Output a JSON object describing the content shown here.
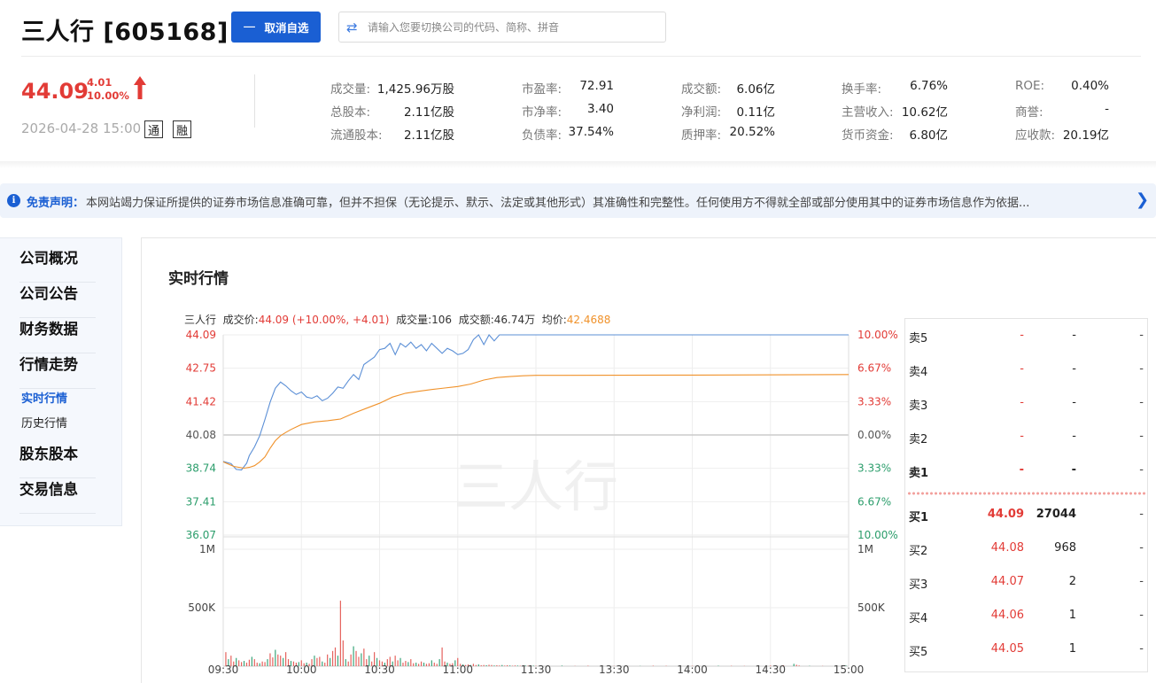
{
  "header": {
    "title": "三人行 [605168]",
    "cancel_button": "取消自选",
    "search_placeholder": "请输入您要切换公司的代码、简称、拼音"
  },
  "quote": {
    "price": "44.09",
    "change": "4.01",
    "change_pct": "10.00%",
    "datetime": "2026-04-28 15:00",
    "tag_tong": "通",
    "tag_rong": "融",
    "stats": [
      {
        "label": "成交量:",
        "value": "1,425.96万股"
      },
      {
        "label": "总股本:",
        "value": "2.11亿股"
      },
      {
        "label": "流通股本:",
        "value": "2.11亿股"
      },
      {
        "label": "市盈率:",
        "value": "72.91"
      },
      {
        "label": "市净率:",
        "value": "3.40"
      },
      {
        "label": "负债率:",
        "value": "37.54%"
      },
      {
        "label": "成交额:",
        "value": "6.06亿"
      },
      {
        "label": "净利润:",
        "value": "0.11亿"
      },
      {
        "label": "质押率:",
        "value": "20.52%"
      },
      {
        "label": "换手率:",
        "value": "6.76%"
      },
      {
        "label": "主营收入:",
        "value": "10.62亿"
      },
      {
        "label": "货币资金:",
        "value": "6.80亿"
      },
      {
        "label": "ROE:",
        "value": "0.40%"
      },
      {
        "label": "商誉:",
        "value": "-"
      },
      {
        "label": "应收款:",
        "value": "20.19亿"
      }
    ]
  },
  "disclaimer": {
    "title": "免责声明：",
    "text": "本网站竭力保证所提供的证券市场信息准确可靠，但并不担保（无论提示、默示、法定或其他形式）其准确性和完整性。任何使用方不得就全部或部分使用其中的证券市场信息作为依据..."
  },
  "sidebar": {
    "items": [
      "公司概况",
      "公司公告",
      "财务数据",
      "行情走势",
      "股东股本",
      "交易信息"
    ],
    "subitems": [
      "实时行情",
      "历史行情"
    ]
  },
  "panel": {
    "title": "实时行情"
  },
  "chart_info": {
    "name": "三人行",
    "price_label": "成交价:",
    "price_value": "44.09 (+10.00%, +4.01)",
    "vol_label": "成交量:",
    "vol_value": "106",
    "amt_label": "成交额:",
    "amt_value": "46.74万",
    "avg_label": "均价:",
    "avg_value": "42.4688"
  },
  "chart_data": {
    "type": "line",
    "watermark": "三人行",
    "y_left_ticks": [
      "44.09",
      "42.75",
      "41.42",
      "40.08",
      "38.74",
      "37.41",
      "36.07"
    ],
    "y_right_ticks": [
      "10.00%",
      "6.67%",
      "3.33%",
      "0.00%",
      "3.33%",
      "6.67%",
      "10.00%"
    ],
    "ylim": [
      36.07,
      44.09
    ],
    "prev_close": 40.08,
    "x_ticks": [
      "09:30",
      "10:00",
      "10:30",
      "11:00",
      "11:30",
      "13:30",
      "14:00",
      "14:30",
      "15:00"
    ],
    "vol_ticks": [
      "1M",
      "500K"
    ],
    "vol_max": 1000000,
    "series": [
      {
        "name": "成交价",
        "color": "#5b8fd6",
        "t": [
          0,
          3,
          5,
          7,
          9,
          10,
          12,
          14,
          16,
          18,
          20,
          22,
          24,
          26,
          28,
          30,
          32,
          34,
          36,
          38,
          40,
          42,
          44,
          46,
          48,
          50,
          52,
          54,
          56,
          58,
          60,
          62,
          64,
          66,
          68,
          70,
          72,
          74,
          76,
          78,
          80,
          82,
          84,
          86,
          88,
          90,
          92,
          94,
          96,
          98,
          100,
          102,
          104,
          106,
          108,
          110,
          112,
          114,
          116,
          118,
          120,
          180,
          240
        ],
        "values": [
          39.02,
          38.93,
          38.7,
          38.68,
          38.95,
          39.25,
          39.6,
          40.05,
          40.7,
          41.4,
          41.95,
          42.2,
          42.05,
          41.85,
          41.7,
          41.8,
          41.6,
          41.55,
          41.65,
          41.45,
          41.55,
          41.75,
          42.0,
          41.95,
          42.25,
          42.5,
          42.3,
          42.9,
          43.05,
          43.2,
          43.5,
          43.55,
          43.75,
          43.3,
          43.75,
          43.6,
          43.8,
          43.55,
          43.7,
          43.45,
          43.75,
          43.55,
          43.35,
          43.55,
          43.45,
          43.3,
          43.35,
          43.5,
          43.9,
          44.09,
          43.7,
          44.09,
          43.85,
          44.09,
          44.09,
          44.09,
          44.09,
          44.09,
          44.09,
          44.09,
          44.09,
          44.09,
          44.09
        ]
      },
      {
        "name": "均价",
        "color": "#f0922b",
        "t": [
          0,
          4,
          8,
          10,
          12,
          14,
          16,
          18,
          20,
          22,
          24,
          26,
          28,
          30,
          35,
          40,
          45,
          50,
          55,
          60,
          65,
          70,
          75,
          80,
          85,
          90,
          95,
          100,
          105,
          110,
          115,
          120,
          180,
          240
        ],
        "values": [
          39.0,
          38.82,
          38.75,
          38.78,
          38.85,
          39.0,
          39.2,
          39.55,
          39.85,
          40.05,
          40.18,
          40.3,
          40.4,
          40.5,
          40.6,
          40.65,
          40.72,
          40.95,
          41.15,
          41.35,
          41.6,
          41.75,
          41.83,
          41.9,
          41.96,
          42.02,
          42.12,
          42.28,
          42.38,
          42.42,
          42.45,
          42.47,
          42.48,
          42.5
        ]
      }
    ],
    "volume": [
      {
        "t": 1,
        "v": 120000
      },
      {
        "t": 2,
        "v": 60000
      },
      {
        "t": 3,
        "v": 90000
      },
      {
        "t": 4,
        "v": 40000
      },
      {
        "t": 5,
        "v": 70000
      },
      {
        "t": 6,
        "v": 50000
      },
      {
        "t": 7,
        "v": 35000
      },
      {
        "t": 8,
        "v": 45000
      },
      {
        "t": 9,
        "v": 30000
      },
      {
        "t": 10,
        "v": 55000
      },
      {
        "t": 11,
        "v": 80000
      },
      {
        "t": 12,
        "v": 60000
      },
      {
        "t": 13,
        "v": 30000
      },
      {
        "t": 14,
        "v": 25000
      },
      {
        "t": 15,
        "v": 40000
      },
      {
        "t": 16,
        "v": 35000
      },
      {
        "t": 17,
        "v": 60000
      },
      {
        "t": 18,
        "v": 110000
      },
      {
        "t": 19,
        "v": 75000
      },
      {
        "t": 20,
        "v": 140000
      },
      {
        "t": 21,
        "v": 100000
      },
      {
        "t": 22,
        "v": 90000
      },
      {
        "t": 23,
        "v": 70000
      },
      {
        "t": 24,
        "v": 120000
      },
      {
        "t": 25,
        "v": 60000
      },
      {
        "t": 26,
        "v": 45000
      },
      {
        "t": 27,
        "v": 40000
      },
      {
        "t": 28,
        "v": 30000
      },
      {
        "t": 29,
        "v": 35000
      },
      {
        "t": 30,
        "v": 50000
      },
      {
        "t": 31,
        "v": 25000
      },
      {
        "t": 32,
        "v": 30000
      },
      {
        "t": 33,
        "v": 20000
      },
      {
        "t": 34,
        "v": 60000
      },
      {
        "t": 35,
        "v": 90000
      },
      {
        "t": 36,
        "v": 70000
      },
      {
        "t": 37,
        "v": 80000
      },
      {
        "t": 38,
        "v": 40000
      },
      {
        "t": 39,
        "v": 30000
      },
      {
        "t": 40,
        "v": 100000
      },
      {
        "t": 41,
        "v": 70000
      },
      {
        "t": 42,
        "v": 130000
      },
      {
        "t": 43,
        "v": 160000
      },
      {
        "t": 44,
        "v": 90000
      },
      {
        "t": 45,
        "v": 560000
      },
      {
        "t": 46,
        "v": 220000
      },
      {
        "t": 47,
        "v": 60000
      },
      {
        "t": 48,
        "v": 40000
      },
      {
        "t": 49,
        "v": 100000
      },
      {
        "t": 50,
        "v": 170000
      },
      {
        "t": 51,
        "v": 130000
      },
      {
        "t": 52,
        "v": 80000
      },
      {
        "t": 53,
        "v": 110000
      },
      {
        "t": 54,
        "v": 150000
      },
      {
        "t": 55,
        "v": 60000
      },
      {
        "t": 56,
        "v": 90000
      },
      {
        "t": 57,
        "v": 40000
      },
      {
        "t": 58,
        "v": 120000
      },
      {
        "t": 59,
        "v": 70000
      },
      {
        "t": 60,
        "v": 50000
      },
      {
        "t": 61,
        "v": 40000
      },
      {
        "t": 62,
        "v": 30000
      },
      {
        "t": 63,
        "v": 60000
      },
      {
        "t": 64,
        "v": 80000
      },
      {
        "t": 65,
        "v": 40000
      },
      {
        "t": 66,
        "v": 90000
      },
      {
        "t": 67,
        "v": 50000
      },
      {
        "t": 68,
        "v": 70000
      },
      {
        "t": 69,
        "v": 30000
      },
      {
        "t": 70,
        "v": 45000
      },
      {
        "t": 71,
        "v": 35000
      },
      {
        "t": 72,
        "v": 60000
      },
      {
        "t": 73,
        "v": 25000
      },
      {
        "t": 74,
        "v": 30000
      },
      {
        "t": 75,
        "v": 20000
      },
      {
        "t": 76,
        "v": 40000
      },
      {
        "t": 77,
        "v": 30000
      },
      {
        "t": 78,
        "v": 20000
      },
      {
        "t": 79,
        "v": 25000
      },
      {
        "t": 80,
        "v": 50000
      },
      {
        "t": 81,
        "v": 30000
      },
      {
        "t": 82,
        "v": 20000
      },
      {
        "t": 83,
        "v": 60000
      },
      {
        "t": 84,
        "v": 160000
      },
      {
        "t": 85,
        "v": 40000
      },
      {
        "t": 86,
        "v": 30000
      },
      {
        "t": 87,
        "v": 20000
      },
      {
        "t": 88,
        "v": 25000
      },
      {
        "t": 89,
        "v": 50000
      },
      {
        "t": 90,
        "v": 70000
      },
      {
        "t": 91,
        "v": 20000
      },
      {
        "t": 92,
        "v": 15000
      },
      {
        "t": 93,
        "v": 10000
      },
      {
        "t": 94,
        "v": 15000
      },
      {
        "t": 95,
        "v": 10000
      },
      {
        "t": 96,
        "v": 20000
      },
      {
        "t": 97,
        "v": 10000
      },
      {
        "t": 98,
        "v": 15000
      },
      {
        "t": 99,
        "v": 8000
      },
      {
        "t": 100,
        "v": 10000
      },
      {
        "t": 101,
        "v": 8000
      },
      {
        "t": 102,
        "v": 12000
      },
      {
        "t": 103,
        "v": 10000
      },
      {
        "t": 104,
        "v": 6000
      },
      {
        "t": 105,
        "v": 8000
      },
      {
        "t": 106,
        "v": 6000
      },
      {
        "t": 107,
        "v": 10000
      },
      {
        "t": 108,
        "v": 5000
      },
      {
        "t": 109,
        "v": 8000
      },
      {
        "t": 110,
        "v": 6000
      },
      {
        "t": 111,
        "v": 4000
      },
      {
        "t": 112,
        "v": 6000
      },
      {
        "t": 113,
        "v": 5000
      },
      {
        "t": 114,
        "v": 4000
      },
      {
        "t": 115,
        "v": 3000
      },
      {
        "t": 116,
        "v": 5000
      },
      {
        "t": 117,
        "v": 4000
      },
      {
        "t": 118,
        "v": 3000
      },
      {
        "t": 119,
        "v": 5000
      },
      {
        "t": 120,
        "v": 3000
      },
      {
        "t": 125,
        "v": 3000
      },
      {
        "t": 130,
        "v": 5000
      },
      {
        "t": 135,
        "v": 2000
      },
      {
        "t": 140,
        "v": 4000
      },
      {
        "t": 145,
        "v": 3000
      },
      {
        "t": 150,
        "v": 2000
      },
      {
        "t": 155,
        "v": 3000
      },
      {
        "t": 160,
        "v": 2000
      },
      {
        "t": 165,
        "v": 4000
      },
      {
        "t": 170,
        "v": 3000
      },
      {
        "t": 175,
        "v": 2000
      },
      {
        "t": 180,
        "v": 3000
      },
      {
        "t": 185,
        "v": 2000
      },
      {
        "t": 190,
        "v": 4000
      },
      {
        "t": 195,
        "v": 3000
      },
      {
        "t": 200,
        "v": 2000
      },
      {
        "t": 205,
        "v": 3000
      },
      {
        "t": 210,
        "v": 5000
      },
      {
        "t": 215,
        "v": 8000
      },
      {
        "t": 219,
        "v": 20000
      },
      {
        "t": 220,
        "v": 12000
      },
      {
        "t": 221,
        "v": 6000
      },
      {
        "t": 225,
        "v": 3000
      },
      {
        "t": 230,
        "v": 2000
      },
      {
        "t": 235,
        "v": 4000
      },
      {
        "t": 239,
        "v": 5000
      }
    ]
  },
  "order_book": {
    "sell": [
      {
        "name": "卖5",
        "price": "-",
        "vol": "-",
        "diff": "-"
      },
      {
        "name": "卖4",
        "price": "-",
        "vol": "-",
        "diff": "-"
      },
      {
        "name": "卖3",
        "price": "-",
        "vol": "-",
        "diff": "-"
      },
      {
        "name": "卖2",
        "price": "-",
        "vol": "-",
        "diff": "-"
      },
      {
        "name": "卖1",
        "price": "-",
        "vol": "-",
        "diff": "-"
      }
    ],
    "buy": [
      {
        "name": "买1",
        "price": "44.09",
        "vol": "27044",
        "diff": "-"
      },
      {
        "name": "买2",
        "price": "44.08",
        "vol": "968",
        "diff": "-"
      },
      {
        "name": "买3",
        "price": "44.07",
        "vol": "2",
        "diff": "-"
      },
      {
        "name": "买4",
        "price": "44.06",
        "vol": "1",
        "diff": "-"
      },
      {
        "name": "买5",
        "price": "44.05",
        "vol": "1",
        "diff": "-"
      }
    ]
  }
}
